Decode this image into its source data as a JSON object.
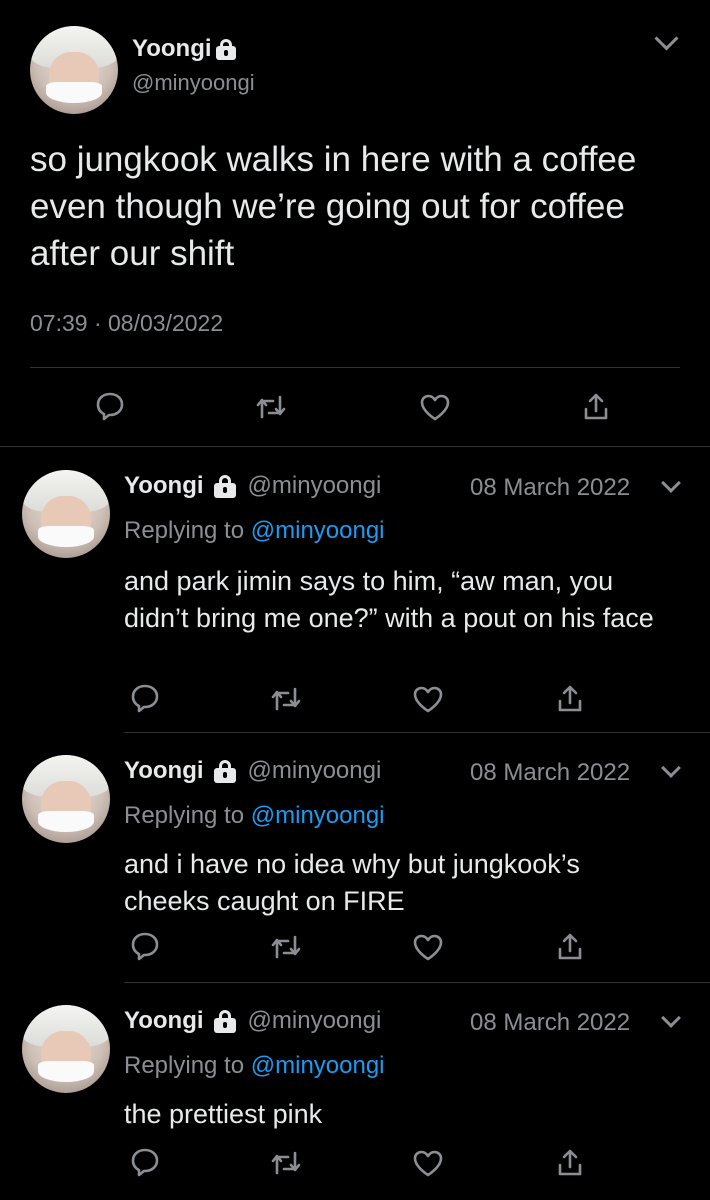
{
  "main_tweet": {
    "name": "Yoongi",
    "handle": "@minyoongi",
    "text": "so jungkook walks in here with a coffee even though we’re going out for coffee after our shift",
    "time": "07:39",
    "separator": "·",
    "date": "08/03/2022"
  },
  "replies": [
    {
      "name": "Yoongi",
      "handle": "@minyoongi",
      "date": "08 March 2022",
      "replying_prefix": "Replying to",
      "replying_to": "@minyoongi",
      "text": "and park jimin says to him, “aw man, you didn’t bring me one?” with a pout on his face"
    },
    {
      "name": "Yoongi",
      "handle": "@minyoongi",
      "date": "08 March 2022",
      "replying_prefix": "Replying to",
      "replying_to": "@minyoongi",
      "text": "and i have no idea why but jungkook’s cheeks caught on FIRE"
    },
    {
      "name": "Yoongi",
      "handle": "@minyoongi",
      "date": "08 March 2022",
      "replying_prefix": "Replying to",
      "replying_to": "@minyoongi",
      "text": "the prettiest pink"
    }
  ],
  "icons": {
    "reply": "reply-icon",
    "retweet": "retweet-icon",
    "like": "heart-icon",
    "share": "share-icon",
    "lock": "lock-icon",
    "more": "chevron-down-icon"
  },
  "colors": {
    "background": "#000000",
    "text": "#e7e9ea",
    "muted": "#8b8f93",
    "link": "#1d9bf0",
    "divider": "#2f3336"
  }
}
